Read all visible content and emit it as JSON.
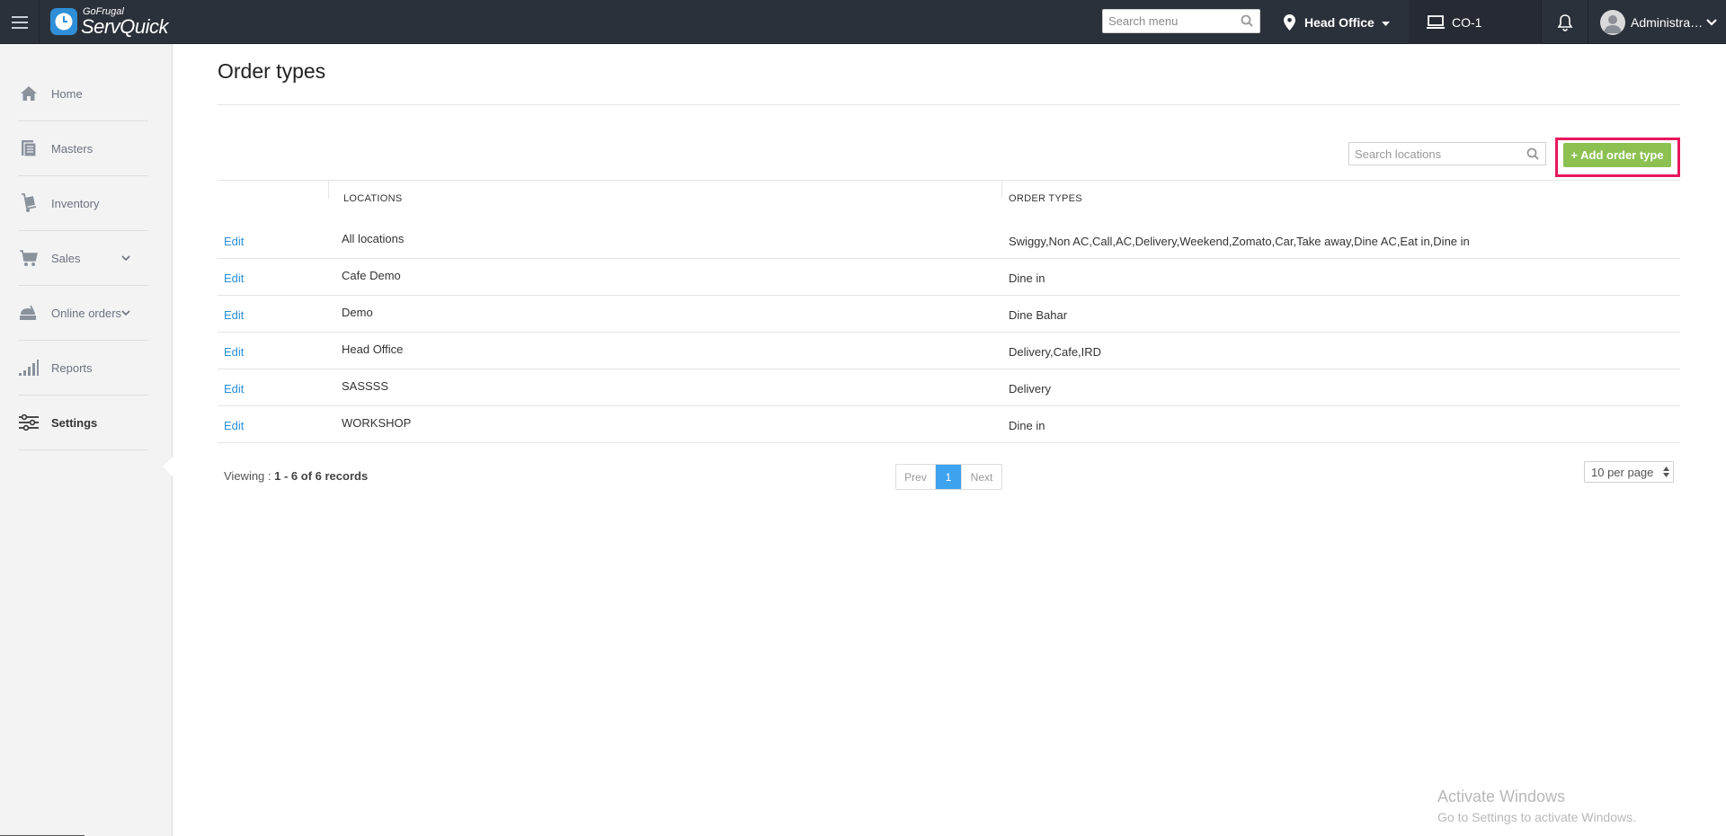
{
  "topbar": {
    "logo_small": "GoFrugal",
    "logo_big": "ServQuick",
    "search_placeholder": "Search menu",
    "location": "Head Office",
    "counter": "CO-1",
    "user": "Administra…"
  },
  "sidebar": {
    "items": [
      {
        "label": "Home",
        "icon": "home-icon"
      },
      {
        "label": "Masters",
        "icon": "masters-icon"
      },
      {
        "label": "Inventory",
        "icon": "inventory-icon"
      },
      {
        "label": "Sales",
        "icon": "cart-icon"
      },
      {
        "label": "Online orders",
        "icon": "online-orders-icon"
      },
      {
        "label": "Reports",
        "icon": "reports-icon"
      },
      {
        "label": "Settings",
        "icon": "settings-icon"
      }
    ]
  },
  "page": {
    "title": "Order types",
    "search_placeholder": "Search locations",
    "add_button": "+ Add order type"
  },
  "table": {
    "columns": [
      "LOCATIONS",
      "ORDER TYPES"
    ],
    "edit_label": "Edit",
    "rows": [
      {
        "location": "All locations",
        "order_types": "Swiggy,Non AC,Call,AC,Delivery,Weekend,Zomato,Car,Take away,Dine AC,Eat in,Dine in"
      },
      {
        "location": "Cafe Demo",
        "order_types": "Dine in"
      },
      {
        "location": "Demo",
        "order_types": "Dine Bahar"
      },
      {
        "location": "Head Office",
        "order_types": "Delivery,Cafe,IRD"
      },
      {
        "location": "SASSSS",
        "order_types": "Delivery"
      },
      {
        "location": "WORKSHOP",
        "order_types": "Dine in"
      }
    ]
  },
  "footer": {
    "viewing_label": "Viewing :",
    "viewing_range": "1 - 6 of 6 records",
    "prev": "Prev",
    "page": "1",
    "next": "Next",
    "per_page": "10 per page"
  },
  "watermark": {
    "line1": "Activate Windows",
    "line2": "Go to Settings to activate Windows."
  }
}
